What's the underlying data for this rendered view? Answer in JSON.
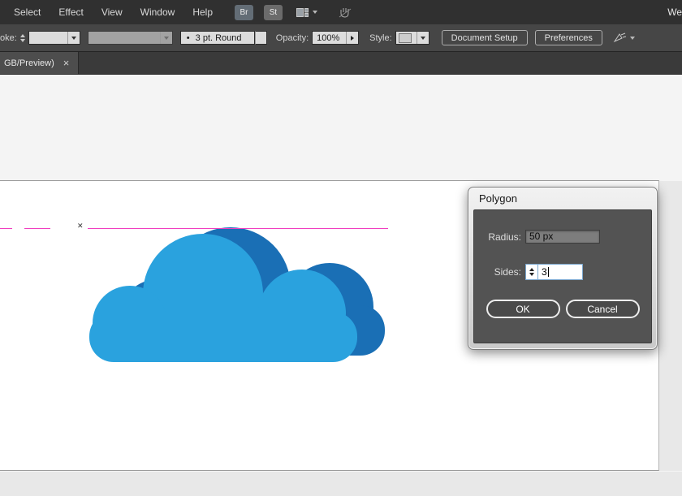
{
  "menu_bar": {
    "items": [
      "Select",
      "Effect",
      "View",
      "Window",
      "Help"
    ],
    "bridge_button": "Br",
    "stock_button": "St",
    "right_truncated_text": "We"
  },
  "control_bar": {
    "stroke_label_truncated": "oke:",
    "stroke_value": "",
    "brush_bullet": "•",
    "brush_value": "3 pt. Round",
    "opacity_label": "Opacity:",
    "opacity_value": "100%",
    "style_label": "Style:",
    "document_setup_button": "Document Setup",
    "preferences_button": "Preferences"
  },
  "tab_bar": {
    "active_tab_truncated": "GB/Preview)",
    "close_glyph": "×"
  },
  "dialog": {
    "title": "Polygon",
    "radius_label": "Radius:",
    "radius_value": "50 px",
    "sides_label": "Sides:",
    "sides_value": "3",
    "ok_button": "OK",
    "cancel_button": "Cancel"
  },
  "canvas": {
    "cloud_front_color": "#2aa2de",
    "cloud_back_color": "#1a6fb5",
    "guide_color": "#f03fc0",
    "anchor_glyph": "✕"
  }
}
